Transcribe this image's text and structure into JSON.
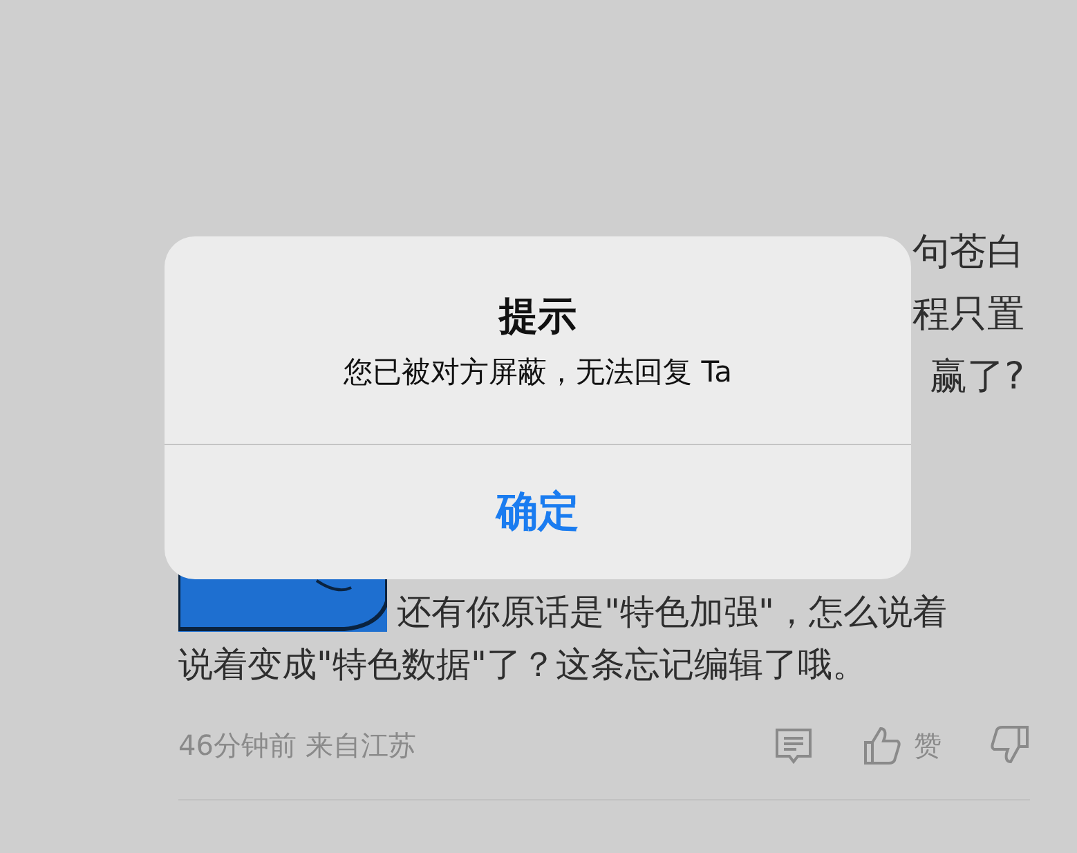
{
  "post_fragments": [
    "句苍白",
    "程只置",
    "赢了?"
  ],
  "comment": {
    "lines": [
      "还有你原话是\"特色加强\"，怎么说着",
      "说着变成\"特色数据\"了？这条忘记编辑了哦。"
    ],
    "meta": "46分钟前 来自江苏",
    "like_label": "赞"
  },
  "alert": {
    "title": "提示",
    "message": "您已被对方屏蔽，无法回复 Ta",
    "button": "确定"
  }
}
